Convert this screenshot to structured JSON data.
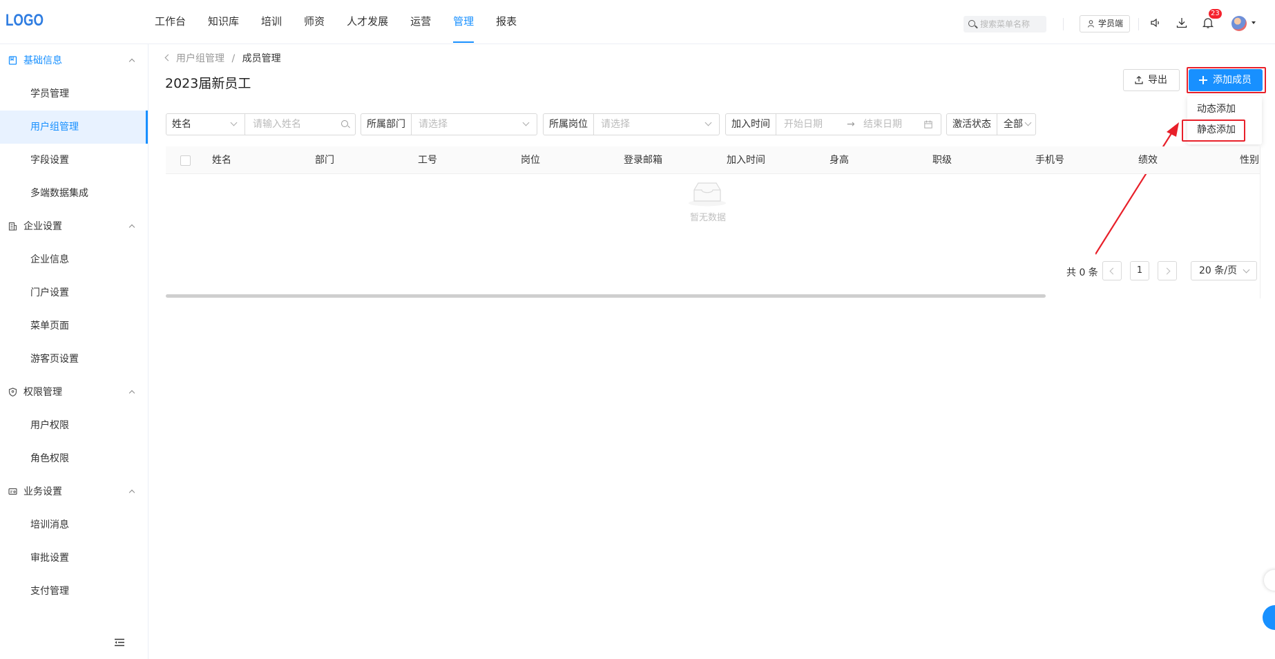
{
  "header": {
    "logo": "LOGO",
    "nav": [
      "工作台",
      "知识库",
      "培训",
      "师资",
      "人才发展",
      "运营",
      "管理",
      "报表"
    ],
    "active_nav": "管理",
    "search_placeholder": "搜索菜单名称",
    "student_button": "学员端",
    "notification_count": "23"
  },
  "sidebar": {
    "groups": [
      {
        "label": "基础信息",
        "icon": "book-icon",
        "items": [
          "学员管理",
          "用户组管理",
          "字段设置",
          "多端数据集成"
        ]
      },
      {
        "label": "企业设置",
        "icon": "building-icon",
        "items": [
          "企业信息",
          "门户设置",
          "菜单页面",
          "游客页设置"
        ]
      },
      {
        "label": "权限管理",
        "icon": "shield-icon",
        "items": [
          "用户权限",
          "角色权限"
        ]
      },
      {
        "label": "业务设置",
        "icon": "card-icon",
        "items": [
          "培训消息",
          "审批设置",
          "支付管理"
        ]
      }
    ],
    "active_item": "用户组管理"
  },
  "breadcrumb": {
    "parent": "用户组管理",
    "separator": "/",
    "current": "成员管理"
  },
  "page_title": "2023届新员工",
  "actions": {
    "export": "导出",
    "add_member": "添加成员"
  },
  "add_menu": [
    "动态添加",
    "静态添加"
  ],
  "filters": {
    "name_type": "姓名",
    "name_placeholder": "请输入姓名",
    "dept_label": "所属部门",
    "dept_placeholder": "请选择",
    "post_label": "所属岗位",
    "post_placeholder": "请选择",
    "join_label": "加入时间",
    "start_placeholder": "开始日期",
    "range_arrow": "→",
    "end_placeholder": "结束日期",
    "active_label": "激活状态",
    "active_value": "全部"
  },
  "table": {
    "columns": [
      "姓名",
      "部门",
      "工号",
      "岗位",
      "登录邮箱",
      "加入时间",
      "身高",
      "职级",
      "手机号",
      "绩效",
      "性别"
    ],
    "empty_text": "暂无数据"
  },
  "pagination": {
    "total": "共 0 条",
    "page": "1",
    "page_size": "20 条/页"
  },
  "colors": {
    "primary": "#1890ff",
    "highlight": "#e8202a"
  }
}
